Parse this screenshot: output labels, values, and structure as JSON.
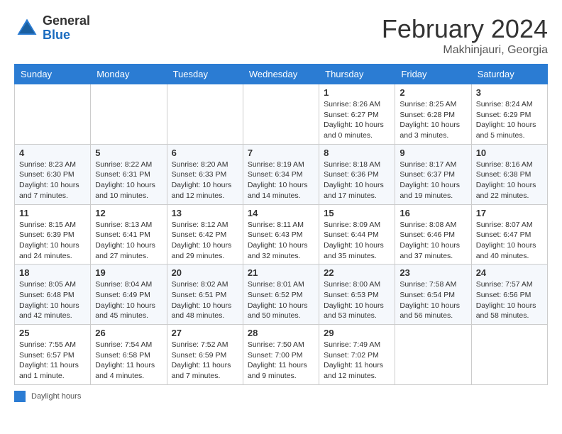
{
  "header": {
    "logo_general": "General",
    "logo_blue": "Blue",
    "month_title": "February 2024",
    "location": "Makhinjauri, Georgia"
  },
  "days_of_week": [
    "Sunday",
    "Monday",
    "Tuesday",
    "Wednesday",
    "Thursday",
    "Friday",
    "Saturday"
  ],
  "legend_label": "Daylight hours",
  "weeks": [
    [
      {
        "num": "",
        "sunrise": "",
        "sunset": "",
        "daylight": ""
      },
      {
        "num": "",
        "sunrise": "",
        "sunset": "",
        "daylight": ""
      },
      {
        "num": "",
        "sunrise": "",
        "sunset": "",
        "daylight": ""
      },
      {
        "num": "",
        "sunrise": "",
        "sunset": "",
        "daylight": ""
      },
      {
        "num": "1",
        "sunrise": "Sunrise: 8:26 AM",
        "sunset": "Sunset: 6:27 PM",
        "daylight": "Daylight: 10 hours and 0 minutes."
      },
      {
        "num": "2",
        "sunrise": "Sunrise: 8:25 AM",
        "sunset": "Sunset: 6:28 PM",
        "daylight": "Daylight: 10 hours and 3 minutes."
      },
      {
        "num": "3",
        "sunrise": "Sunrise: 8:24 AM",
        "sunset": "Sunset: 6:29 PM",
        "daylight": "Daylight: 10 hours and 5 minutes."
      }
    ],
    [
      {
        "num": "4",
        "sunrise": "Sunrise: 8:23 AM",
        "sunset": "Sunset: 6:30 PM",
        "daylight": "Daylight: 10 hours and 7 minutes."
      },
      {
        "num": "5",
        "sunrise": "Sunrise: 8:22 AM",
        "sunset": "Sunset: 6:31 PM",
        "daylight": "Daylight: 10 hours and 10 minutes."
      },
      {
        "num": "6",
        "sunrise": "Sunrise: 8:20 AM",
        "sunset": "Sunset: 6:33 PM",
        "daylight": "Daylight: 10 hours and 12 minutes."
      },
      {
        "num": "7",
        "sunrise": "Sunrise: 8:19 AM",
        "sunset": "Sunset: 6:34 PM",
        "daylight": "Daylight: 10 hours and 14 minutes."
      },
      {
        "num": "8",
        "sunrise": "Sunrise: 8:18 AM",
        "sunset": "Sunset: 6:36 PM",
        "daylight": "Daylight: 10 hours and 17 minutes."
      },
      {
        "num": "9",
        "sunrise": "Sunrise: 8:17 AM",
        "sunset": "Sunset: 6:37 PM",
        "daylight": "Daylight: 10 hours and 19 minutes."
      },
      {
        "num": "10",
        "sunrise": "Sunrise: 8:16 AM",
        "sunset": "Sunset: 6:38 PM",
        "daylight": "Daylight: 10 hours and 22 minutes."
      }
    ],
    [
      {
        "num": "11",
        "sunrise": "Sunrise: 8:15 AM",
        "sunset": "Sunset: 6:39 PM",
        "daylight": "Daylight: 10 hours and 24 minutes."
      },
      {
        "num": "12",
        "sunrise": "Sunrise: 8:13 AM",
        "sunset": "Sunset: 6:41 PM",
        "daylight": "Daylight: 10 hours and 27 minutes."
      },
      {
        "num": "13",
        "sunrise": "Sunrise: 8:12 AM",
        "sunset": "Sunset: 6:42 PM",
        "daylight": "Daylight: 10 hours and 29 minutes."
      },
      {
        "num": "14",
        "sunrise": "Sunrise: 8:11 AM",
        "sunset": "Sunset: 6:43 PM",
        "daylight": "Daylight: 10 hours and 32 minutes."
      },
      {
        "num": "15",
        "sunrise": "Sunrise: 8:09 AM",
        "sunset": "Sunset: 6:44 PM",
        "daylight": "Daylight: 10 hours and 35 minutes."
      },
      {
        "num": "16",
        "sunrise": "Sunrise: 8:08 AM",
        "sunset": "Sunset: 6:46 PM",
        "daylight": "Daylight: 10 hours and 37 minutes."
      },
      {
        "num": "17",
        "sunrise": "Sunrise: 8:07 AM",
        "sunset": "Sunset: 6:47 PM",
        "daylight": "Daylight: 10 hours and 40 minutes."
      }
    ],
    [
      {
        "num": "18",
        "sunrise": "Sunrise: 8:05 AM",
        "sunset": "Sunset: 6:48 PM",
        "daylight": "Daylight: 10 hours and 42 minutes."
      },
      {
        "num": "19",
        "sunrise": "Sunrise: 8:04 AM",
        "sunset": "Sunset: 6:49 PM",
        "daylight": "Daylight: 10 hours and 45 minutes."
      },
      {
        "num": "20",
        "sunrise": "Sunrise: 8:02 AM",
        "sunset": "Sunset: 6:51 PM",
        "daylight": "Daylight: 10 hours and 48 minutes."
      },
      {
        "num": "21",
        "sunrise": "Sunrise: 8:01 AM",
        "sunset": "Sunset: 6:52 PM",
        "daylight": "Daylight: 10 hours and 50 minutes."
      },
      {
        "num": "22",
        "sunrise": "Sunrise: 8:00 AM",
        "sunset": "Sunset: 6:53 PM",
        "daylight": "Daylight: 10 hours and 53 minutes."
      },
      {
        "num": "23",
        "sunrise": "Sunrise: 7:58 AM",
        "sunset": "Sunset: 6:54 PM",
        "daylight": "Daylight: 10 hours and 56 minutes."
      },
      {
        "num": "24",
        "sunrise": "Sunrise: 7:57 AM",
        "sunset": "Sunset: 6:56 PM",
        "daylight": "Daylight: 10 hours and 58 minutes."
      }
    ],
    [
      {
        "num": "25",
        "sunrise": "Sunrise: 7:55 AM",
        "sunset": "Sunset: 6:57 PM",
        "daylight": "Daylight: 11 hours and 1 minute."
      },
      {
        "num": "26",
        "sunrise": "Sunrise: 7:54 AM",
        "sunset": "Sunset: 6:58 PM",
        "daylight": "Daylight: 11 hours and 4 minutes."
      },
      {
        "num": "27",
        "sunrise": "Sunrise: 7:52 AM",
        "sunset": "Sunset: 6:59 PM",
        "daylight": "Daylight: 11 hours and 7 minutes."
      },
      {
        "num": "28",
        "sunrise": "Sunrise: 7:50 AM",
        "sunset": "Sunset: 7:00 PM",
        "daylight": "Daylight: 11 hours and 9 minutes."
      },
      {
        "num": "29",
        "sunrise": "Sunrise: 7:49 AM",
        "sunset": "Sunset: 7:02 PM",
        "daylight": "Daylight: 11 hours and 12 minutes."
      },
      {
        "num": "",
        "sunrise": "",
        "sunset": "",
        "daylight": ""
      },
      {
        "num": "",
        "sunrise": "",
        "sunset": "",
        "daylight": ""
      }
    ]
  ]
}
